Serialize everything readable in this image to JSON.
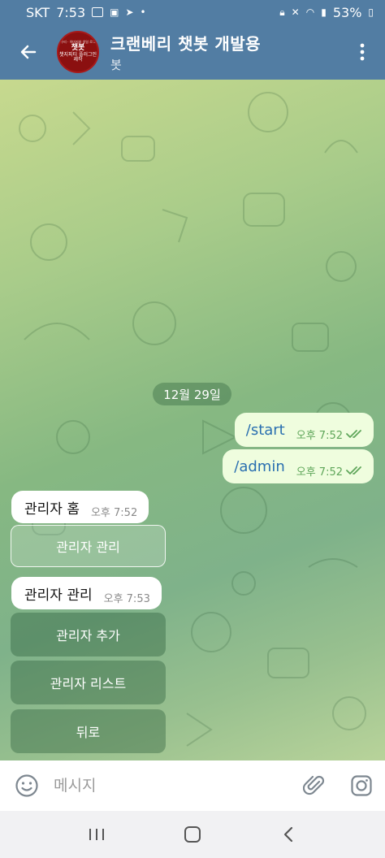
{
  "status_bar": {
    "carrier": "SKT",
    "time": "7:53",
    "battery": "53%"
  },
  "header": {
    "title": "크랜베리 챗봇 개발용",
    "subtitle": "봇",
    "avatar": {
      "top": "구리 · 이미지와 생일 로그",
      "main": "챗봇",
      "sub": "챗지피티 플러그인 제작"
    }
  },
  "chat": {
    "date_label": "12월 29일",
    "outgoing": [
      {
        "text": "/start",
        "time": "오후 7:52"
      },
      {
        "text": "/admin",
        "time": "오후 7:52"
      }
    ],
    "incoming": [
      {
        "text": "관리자 홈",
        "time": "오후 7:52"
      },
      {
        "text": "관리자 관리",
        "time": "오후 7:53"
      }
    ],
    "keyboard_1": [
      "관리자 관리"
    ],
    "keyboard_2": [
      "관리자 추가",
      "관리자 리스트",
      "뒤로"
    ]
  },
  "input": {
    "placeholder": "메시지"
  },
  "icons": {
    "back": "arrow-left-icon",
    "menu": "more-vertical-icon",
    "emoji": "emoji-icon",
    "attach": "paperclip-icon",
    "camera": "camera-icon",
    "read": "double-check-icon"
  },
  "colors": {
    "header": "#527da3",
    "out_bubble": "#effdde",
    "link": "#2a6fb0",
    "check": "#5fa65a"
  }
}
